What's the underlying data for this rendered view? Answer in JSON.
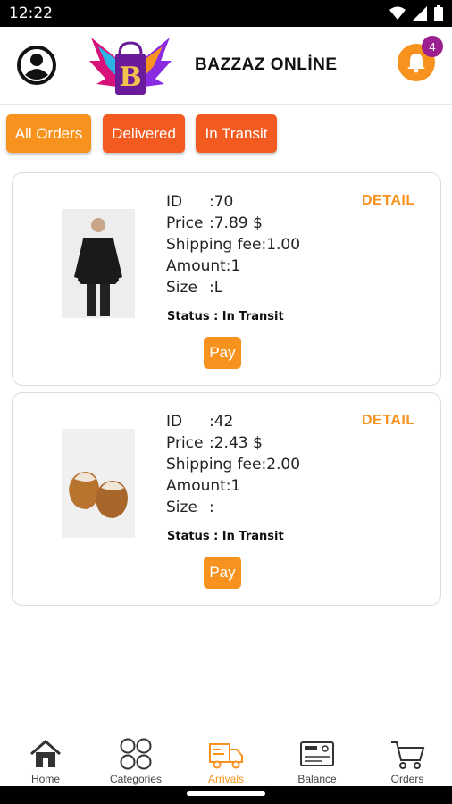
{
  "status_bar": {
    "time": "12:22"
  },
  "header": {
    "brand": "BAZZAZ ONLİNE",
    "notification_count": "4"
  },
  "tabs": [
    {
      "label": "All Orders"
    },
    {
      "label": "Delivered"
    },
    {
      "label": "In Transit"
    }
  ],
  "orders": [
    {
      "id_label": "ID",
      "id_value": ":70",
      "price_label": "Price",
      "price_value": ":7.89 $",
      "shipping": "Shipping fee:1.00",
      "amount": "Amount:1",
      "size_label": "Size",
      "size_value": ":L",
      "status": "Status :  In Transit",
      "detail": "DETAIL",
      "pay": "Pay"
    },
    {
      "id_label": "ID",
      "id_value": ":42",
      "price_label": "Price",
      "price_value": ":2.43 $",
      "shipping": "Shipping fee:2.00",
      "amount": "Amount:1",
      "size_label": "Size",
      "size_value": ":",
      "status": "Status :  In Transit",
      "detail": "DETAIL",
      "pay": "Pay"
    }
  ],
  "nav": [
    {
      "label": "Home",
      "icon": "home-icon"
    },
    {
      "label": "Categories",
      "icon": "categories-icon"
    },
    {
      "label": "Arrivals",
      "icon": "truck-icon",
      "active": true
    },
    {
      "label": "Balance",
      "icon": "card-icon"
    },
    {
      "label": "Orders",
      "icon": "cart-icon"
    }
  ],
  "colors": {
    "accent": "#f7921e",
    "tab_inactive": "#f25a1f",
    "badge": "#9c1f8f"
  }
}
